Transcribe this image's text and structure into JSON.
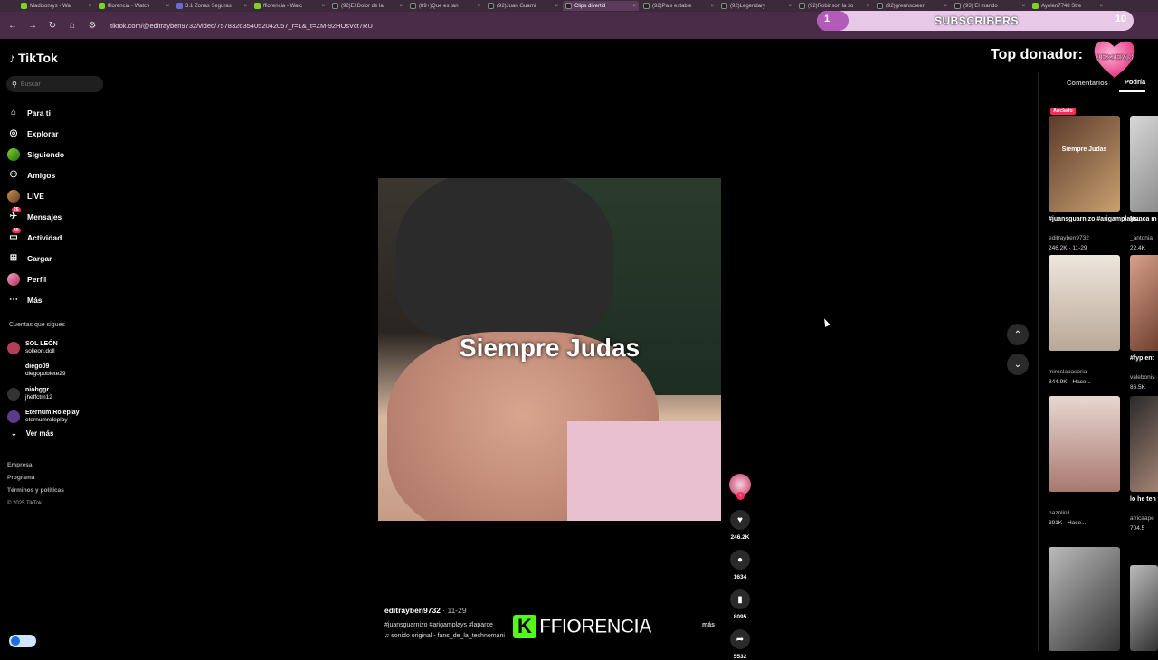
{
  "browser": {
    "tabs": [
      {
        "label": "Madisonrys - Wa",
        "kind": "kick",
        "active": false
      },
      {
        "label": "ffiorencia - Watch",
        "kind": "kick",
        "active": false
      },
      {
        "label": "3.1 Zonas Seguras",
        "kind": "other",
        "active": false
      },
      {
        "label": "ffiorencia - Watc",
        "kind": "kick",
        "active": false
      },
      {
        "label": "(92)El Dolor de la",
        "kind": "tiktok",
        "active": false
      },
      {
        "label": "(89+)Que es tan",
        "kind": "tiktok",
        "active": false
      },
      {
        "label": "(92)Juan Guarni",
        "kind": "tiktok",
        "active": false
      },
      {
        "label": "Clips divertid",
        "kind": "tiktok",
        "active": true
      },
      {
        "label": "(92)Pais estable",
        "kind": "tiktok",
        "active": false
      },
      {
        "label": "(92)Legendary",
        "kind": "tiktok",
        "active": false
      },
      {
        "label": "(92)Robinson la so",
        "kind": "tiktok",
        "active": false
      },
      {
        "label": "(92)greenscreen",
        "kind": "tiktok",
        "active": false
      },
      {
        "label": "(93) El mando",
        "kind": "tiktok",
        "active": false
      },
      {
        "label": "Ayelen7748 Stre",
        "kind": "kick",
        "active": false
      }
    ],
    "url": "tiktok.com/@editrayben9732/video/7578326354052042057_r=1&_t=ZM-92HOsVct7RU"
  },
  "subscriber_goal": {
    "label": "SUBSCRIBERS",
    "current": "1",
    "goal": "10",
    "progress": 0.1
  },
  "donor": {
    "label": "Top donador:",
    "name": "JESSER18"
  },
  "sidebar": {
    "logo": "TikTok",
    "search_placeholder": "Buscar",
    "nav": [
      {
        "label": "Para ti",
        "icon": "home-icon"
      },
      {
        "label": "Explorar",
        "icon": "compass-icon"
      },
      {
        "label": "Siguiendo",
        "icon": "following-icon"
      },
      {
        "label": "Amigos",
        "icon": "friends-icon"
      },
      {
        "label": "LIVE",
        "icon": "live-icon"
      },
      {
        "label": "Mensajes",
        "icon": "messages-icon",
        "badge": "26"
      },
      {
        "label": "Actividad",
        "icon": "activity-icon",
        "badge": "30"
      },
      {
        "label": "Cargar",
        "icon": "upload-icon"
      },
      {
        "label": "Perfil",
        "icon": "profile-icon"
      },
      {
        "label": "Más",
        "icon": "more-icon"
      }
    ],
    "following_title": "Cuentas que sigues",
    "following": [
      {
        "name": "SOL LEÓN",
        "handle": "solleon.doll",
        "color": "#b0405a"
      },
      {
        "name": "diego09",
        "handle": "diegopoblete29",
        "color": "#000"
      },
      {
        "name": "niohggr",
        "handle": "jheffctm12",
        "color": "#333"
      },
      {
        "name": "Eternum Roleplay",
        "handle": "eternumroleplay",
        "color": "#5b3a8a"
      }
    ],
    "see_more": "Ver más",
    "footer": [
      "Empresa",
      "Programa",
      "Términos y políticas"
    ],
    "copyright": "© 2025 TikTok"
  },
  "video": {
    "caption": "Siempre Judas",
    "author": "editrayben9732",
    "date": "· 11-29",
    "tags": "#juansguarnizo #arigamplays #laparce",
    "more": "más",
    "sound": "sonido original - fans_de_la_technomani"
  },
  "actions": {
    "likes": "246.2K",
    "comments": "1634",
    "saves": "8095",
    "shares": "5532"
  },
  "overlay": {
    "name": "FFIORENCIA",
    "k": "K"
  },
  "right_panel": {
    "tabs": [
      "Comentarios",
      "Podría"
    ],
    "pinned": "Anclado",
    "items": [
      {
        "caption": "#juansguarnizo #arigamplays...",
        "user": "editrayben9732",
        "stat": "246.2K · 11-29",
        "thumb_text": "Siempre Judas"
      },
      {
        "caption": "Nunca m aprende",
        "user": "_antoniaj",
        "stat": "22.4K"
      },
      {
        "caption": "",
        "user": "miroslabasoria",
        "stat": "844.9K · Hace..."
      },
      {
        "caption": "#fyp ent",
        "user": "valebonis",
        "stat": "86.5K"
      },
      {
        "caption": "",
        "user": "naznlinil",
        "stat": "391K · Hace..."
      },
      {
        "caption": "lo he ten volver a",
        "user": "africaape",
        "stat": "704.5"
      }
    ]
  }
}
